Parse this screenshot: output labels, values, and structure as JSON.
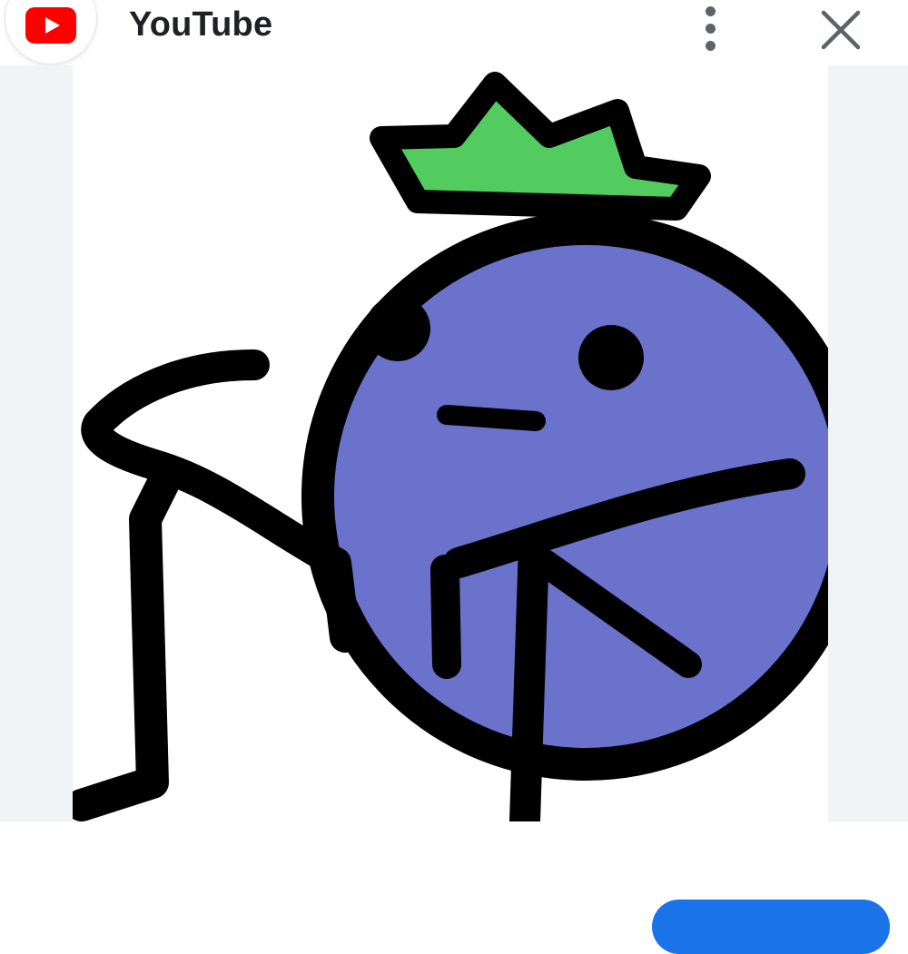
{
  "app": {
    "title": "YouTube",
    "icon": "youtube-logo",
    "brand_color": "#ff0000"
  },
  "toolbar": {
    "menu_icon": "more-vert-icon",
    "close_icon": "close-icon"
  },
  "image": {
    "subject": "blueberry-character-illustration",
    "colors": {
      "body": "#6b72cc",
      "leaf": "#52cc5f",
      "outline": "#000000"
    }
  },
  "bottom": {
    "button_color": "#1a73e8"
  }
}
